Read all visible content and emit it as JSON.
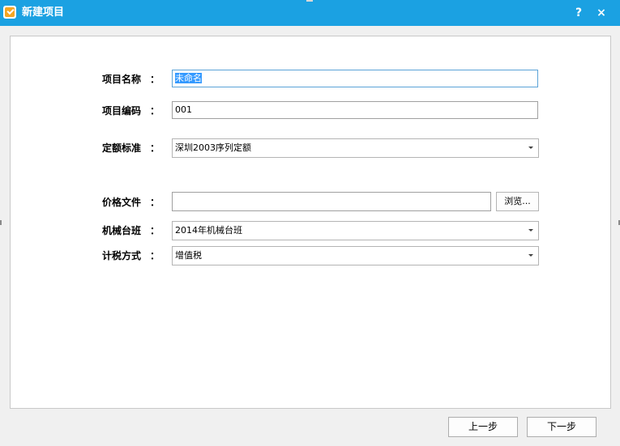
{
  "window": {
    "title": "新建项目",
    "help_label": "?",
    "close_label": "×"
  },
  "form": {
    "project_name": {
      "label": "项目名称",
      "colon": "：",
      "value": "未命名"
    },
    "project_code": {
      "label": "项目编码",
      "colon": "：",
      "value": "001"
    },
    "quota_standard": {
      "label": "定额标准",
      "colon": "：",
      "value": "深圳2003序列定额"
    },
    "price_file": {
      "label": "价格文件",
      "colon": "：",
      "value": "",
      "browse_label": "浏览..."
    },
    "machine_shift": {
      "label": "机械台班",
      "colon": "：",
      "value": "2014年机械台班"
    },
    "tax_method": {
      "label": "计税方式",
      "colon": "：",
      "value": "增值税"
    }
  },
  "footer": {
    "prev_label": "上一步",
    "next_label": "下一步"
  },
  "colors": {
    "titlebar": "#1ba1e2",
    "selection": "#3399ff",
    "background": "#f0f0f0"
  }
}
